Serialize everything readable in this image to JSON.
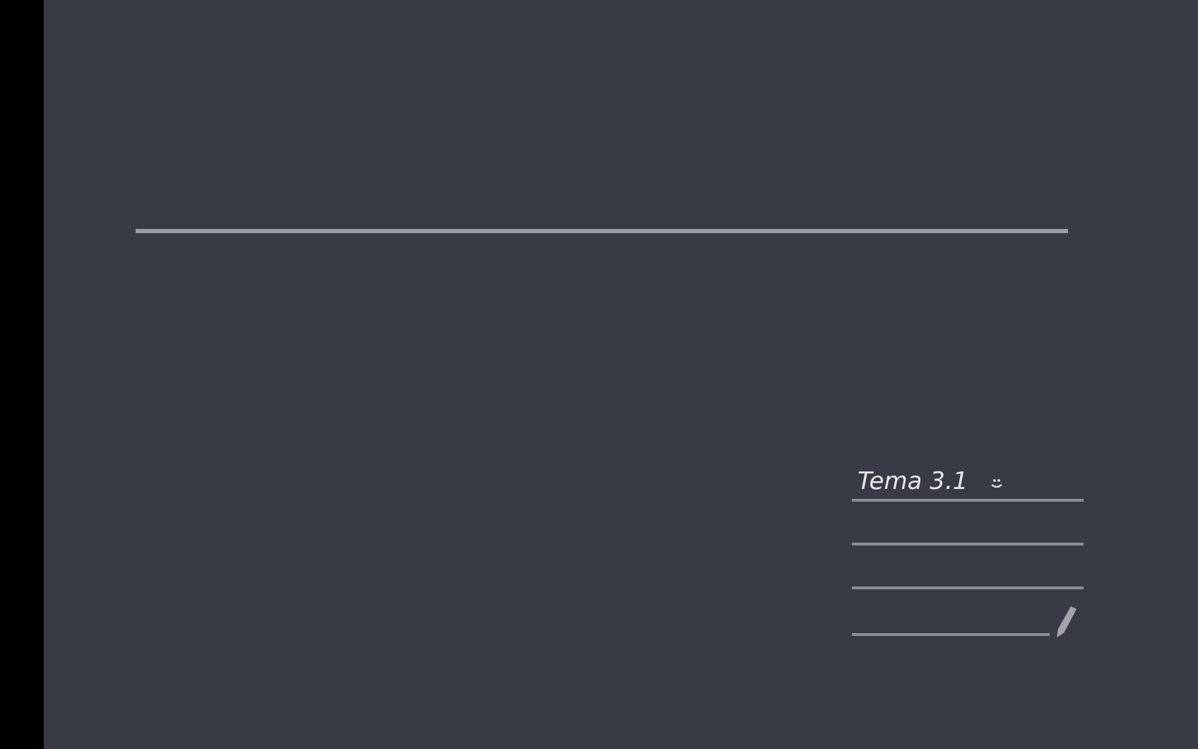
{
  "note": {
    "title": "Tema 3.1"
  }
}
